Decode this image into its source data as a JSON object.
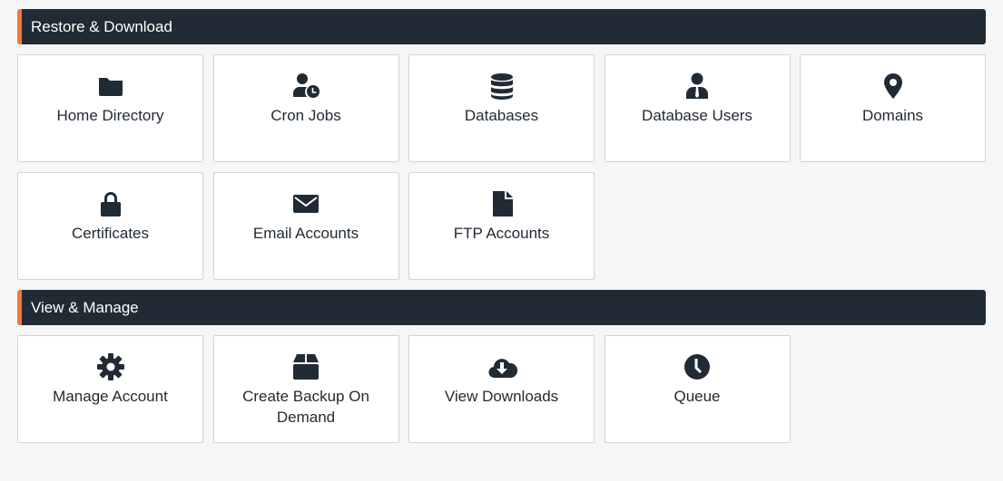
{
  "sections": [
    {
      "title": "Restore & Download",
      "items": [
        {
          "label": "Home Directory",
          "icon": "folder-icon"
        },
        {
          "label": "Cron Jobs",
          "icon": "user-clock-icon"
        },
        {
          "label": "Databases",
          "icon": "database-icon"
        },
        {
          "label": "Database Users",
          "icon": "user-tie-icon"
        },
        {
          "label": "Domains",
          "icon": "map-marker-icon"
        },
        {
          "label": "Certificates",
          "icon": "lock-icon"
        },
        {
          "label": "Email Accounts",
          "icon": "envelope-icon"
        },
        {
          "label": "FTP Accounts",
          "icon": "file-icon"
        }
      ]
    },
    {
      "title": "View & Manage",
      "items": [
        {
          "label": "Manage Account",
          "icon": "gear-icon"
        },
        {
          "label": "Create Backup On Demand",
          "icon": "box-icon"
        },
        {
          "label": "View Downloads",
          "icon": "cloud-download-icon"
        },
        {
          "label": "Queue",
          "icon": "clock-icon"
        }
      ]
    }
  ],
  "colors": {
    "header": "#212b35",
    "accent": "#ef7a3b"
  }
}
